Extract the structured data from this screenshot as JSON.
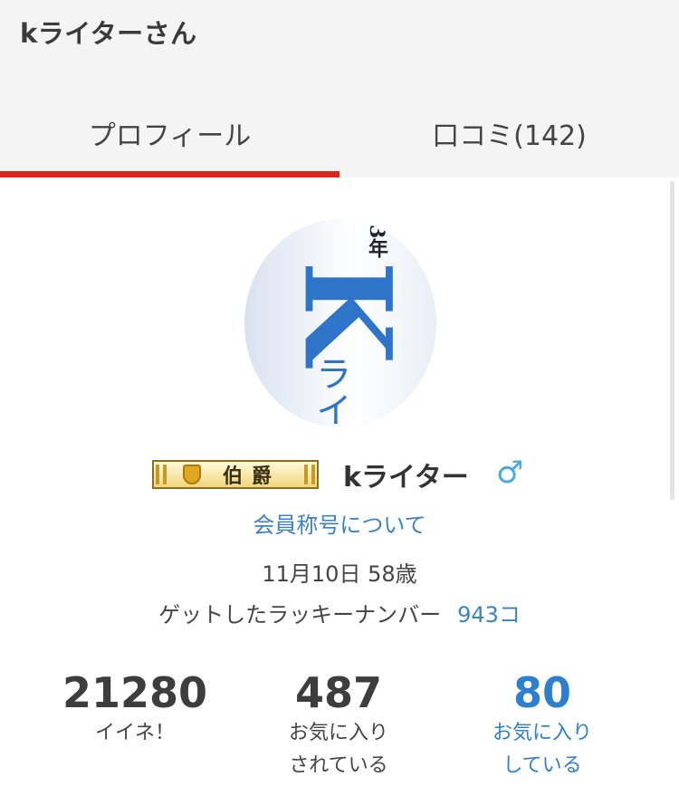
{
  "header": {
    "title": "kライターさん",
    "tabs": [
      {
        "label": "プロフィール",
        "active": true
      },
      {
        "label": "口コミ(142)",
        "active": false
      }
    ],
    "active_color": "#d9291c"
  },
  "profile": {
    "avatar": {
      "year_text": "3年",
      "letter": "K",
      "kana": "ライ"
    },
    "rank_badge": "伯爵",
    "username": "kライター",
    "gender_icon": "male-icon",
    "gender_symbol": "♂",
    "member_title_link": "会員称号について",
    "birthday_age": "11月10日 58歳",
    "lucky_label": "ゲットしたラッキーナンバー",
    "lucky_value": "943コ"
  },
  "stats": [
    {
      "value": "21280",
      "label": "イイネ！"
    },
    {
      "value": "487",
      "label_line1": "お気に入り",
      "label_line2": "されている"
    },
    {
      "value": "80",
      "label_line1": "お気に入り",
      "label_line2": "している"
    }
  ],
  "colors": {
    "link": "#3b82c9",
    "accent": "#d9291c",
    "gender": "#4aa9e0"
  }
}
